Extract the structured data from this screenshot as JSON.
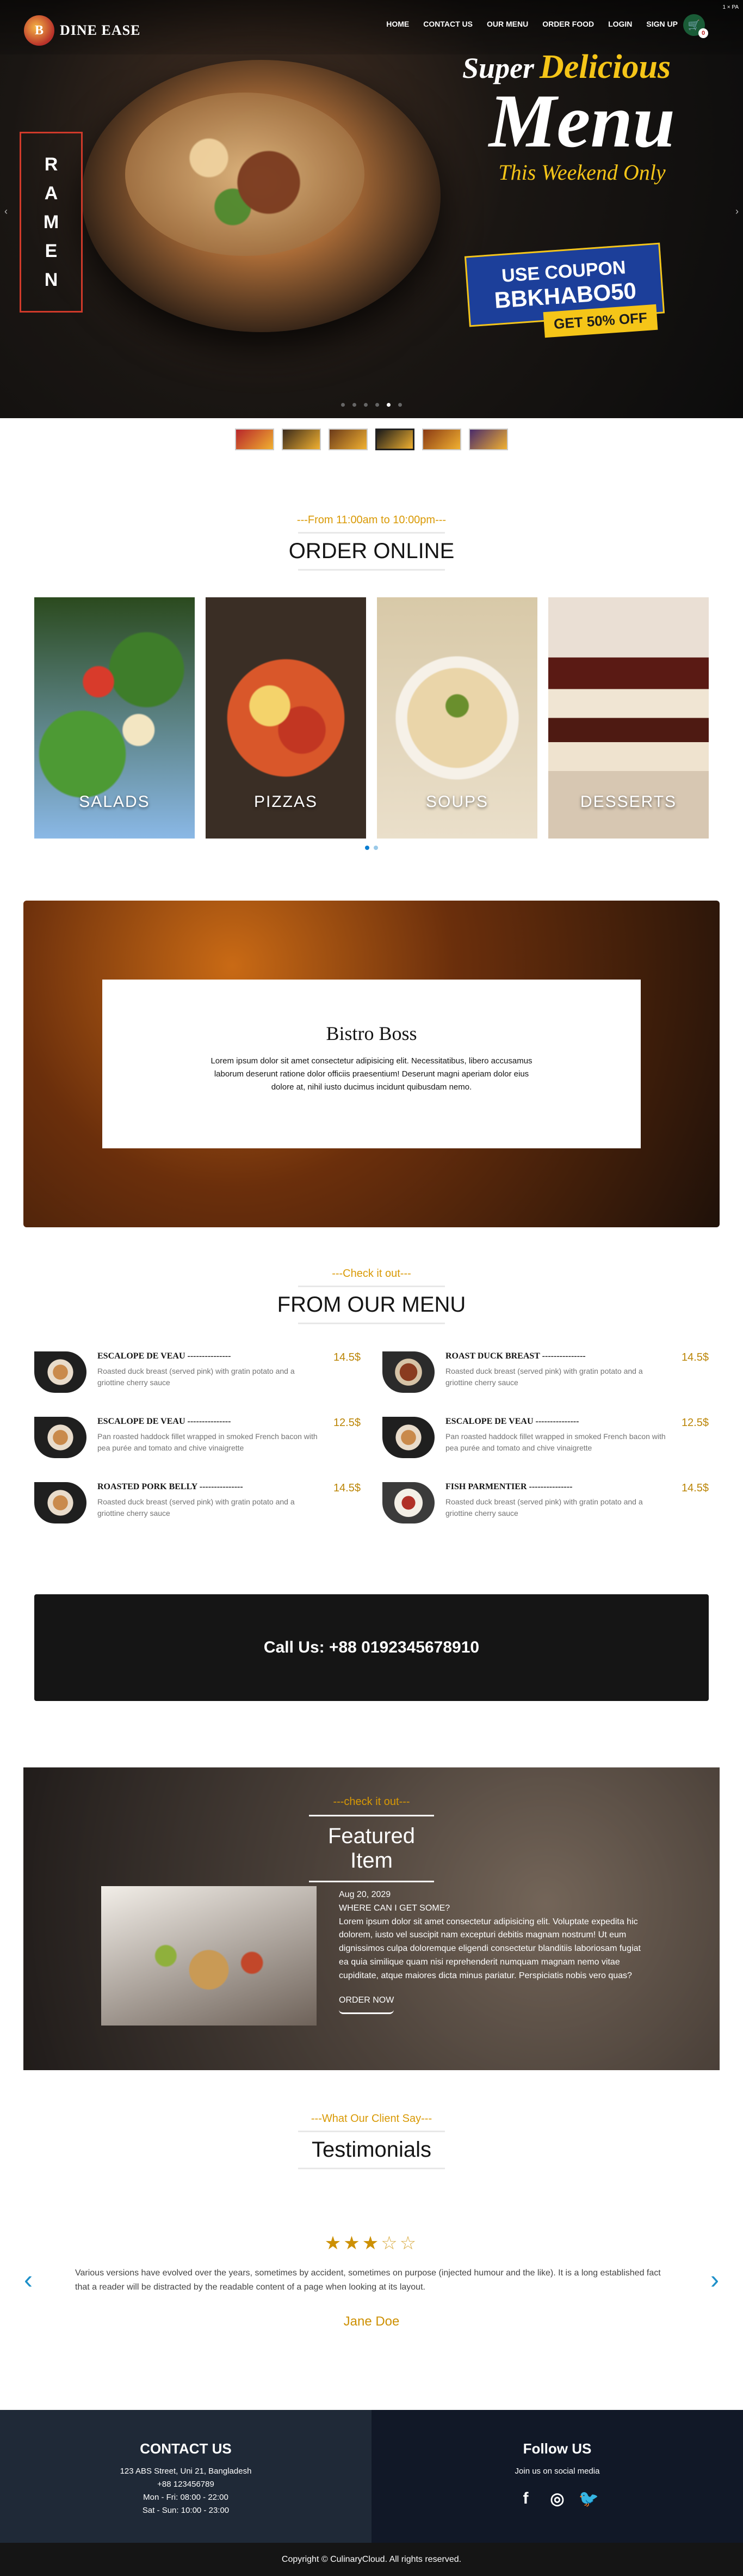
{
  "brand": {
    "name": "DINE EASE",
    "logo_text": "B"
  },
  "nav": {
    "links": [
      "HOME",
      "CONTACT US",
      "OUR MENU",
      "ORDER FOOD",
      "LOGIN",
      "SIGN UP"
    ],
    "cart_count": "0",
    "corner_badge": "1 × PA"
  },
  "hero": {
    "side_word": [
      "R",
      "A",
      "M",
      "E",
      "N"
    ],
    "promo_super": "Super",
    "promo_delicious": "Delicious",
    "promo_menu": "Menu",
    "promo_weekend": "This Weekend Only",
    "coupon_label": "USE COUPON",
    "coupon_code": "BBKHABO50",
    "offer": "GET 50% OFF",
    "slide_count": 6,
    "active_slide": 4
  },
  "thumbs": {
    "count": 6,
    "active": 3
  },
  "order_online": {
    "subtitle": "---From 11:00am to 10:00pm---",
    "title": "ORDER ONLINE"
  },
  "categories": [
    {
      "name": "SALADS",
      "key": "salads"
    },
    {
      "name": "PIZZAS",
      "key": "pizzas"
    },
    {
      "name": "SOUPS",
      "key": "soups"
    },
    {
      "name": "DESSERTS",
      "key": "desserts"
    }
  ],
  "bistro": {
    "title": "Bistro Boss",
    "text": "Lorem ipsum dolor sit amet consectetur adipisicing elit. Necessitatibus, libero accusamus laborum deserunt ratione dolor officiis praesentium! Deserunt magni aperiam dolor eius dolore at, nihil iusto ducimus incidunt quibusdam nemo."
  },
  "menu_section": {
    "subtitle": "---Check it out---",
    "title": "FROM OUR MENU"
  },
  "menu_items": [
    {
      "name": "ESCALOPE DE VEAU ---------------",
      "desc": "Roasted duck breast (served pink) with gratin potato and a griottine cherry sauce",
      "price": "14.5$",
      "img": "a"
    },
    {
      "name": "ROAST DUCK BREAST ---------------",
      "desc": "Roasted duck breast (served pink) with gratin potato and a griottine cherry sauce",
      "price": "14.5$",
      "img": "b"
    },
    {
      "name": "ESCALOPE DE VEAU ---------------",
      "desc": "Pan roasted haddock fillet wrapped in smoked French bacon with pea purée and tomato and chive vinaigrette",
      "price": "12.5$",
      "img": "a"
    },
    {
      "name": "ESCALOPE DE VEAU ---------------",
      "desc": "Pan roasted haddock fillet wrapped in smoked French bacon with pea purée and tomato and chive vinaigrette",
      "price": "12.5$",
      "img": "a"
    },
    {
      "name": "ROASTED PORK BELLY ---------------",
      "desc": "Roasted duck breast (served pink) with gratin potato and a griottine cherry sauce",
      "price": "14.5$",
      "img": "a"
    },
    {
      "name": "FISH PARMENTIER ---------------",
      "desc": "Roasted duck breast (served pink) with gratin potato and a griottine cherry sauce",
      "price": "14.5$",
      "img": "c"
    }
  ],
  "call": {
    "text": "Call Us: +88 0192345678910"
  },
  "featured": {
    "subtitle": "---check it out---",
    "title": "Featured Item",
    "date": "Aug 20, 2029",
    "question": "WHERE CAN I GET SOME?",
    "text": "Lorem ipsum dolor sit amet consectetur adipisicing elit. Voluptate expedita hic dolorem, iusto vel suscipit nam excepturi debitis magnam nostrum! Ut eum dignissimos culpa doloremque eligendi consectetur blanditiis laboriosam fugiat ea quia similique quam nisi reprehenderit numquam magnam nemo vitae cupiditate, atque maiores dicta minus pariatur. Perspiciatis nobis vero quas?",
    "button": "ORDER NOW"
  },
  "testimonials": {
    "subtitle": "---What Our Client Say---",
    "title": "Testimonials",
    "rating": 3,
    "max_rating": 5,
    "text": "Various versions have evolved over the years, sometimes by accident, sometimes on purpose (injected humour and the like). It is a long established fact that a reader will be distracted by the readable content of a page when looking at its layout.",
    "name": "Jane Doe",
    "prev_icon": "‹",
    "next_icon": "›"
  },
  "footer": {
    "contact_title": "CONTACT US",
    "contact_lines": [
      "123 ABS Street, Uni 21, Bangladesh",
      "+88 123456789",
      "Mon - Fri: 08:00 - 22:00",
      "Sat - Sun: 10:00 - 23:00"
    ],
    "follow_title": "Follow US",
    "follow_sub": "Join us on social media",
    "socials": [
      {
        "name": "facebook",
        "glyph": "f"
      },
      {
        "name": "instagram",
        "glyph": "◎"
      },
      {
        "name": "twitter",
        "glyph": "🐦"
      }
    ],
    "copyright": "Copyright © CulinaryCloud. All rights reserved."
  },
  "colors": {
    "accent_gold": "#D99904",
    "navy": "#1F2937",
    "dark": "#151515",
    "coupon_blue": "#1C3F9A",
    "coupon_yellow": "#F5C518"
  }
}
